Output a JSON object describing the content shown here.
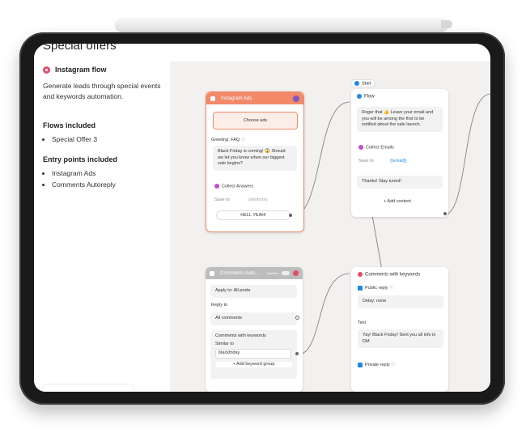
{
  "sidebar": {
    "title": "Special offers",
    "flow_name": "Instagram flow",
    "description": "Generate leads through special events and keywords automation.",
    "flows_heading": "Flows included",
    "flows": [
      "Special Offer 3"
    ],
    "entry_heading": "Entry points included",
    "entry_points": [
      "Instagram Ads",
      "Comments Autoreply"
    ]
  },
  "canvas": {
    "start_label": "Start",
    "ig_ads": {
      "title": "Instagram Ads",
      "choose_ads": "Choose ads",
      "greeting": "Greeting: FAQ",
      "message": "Black Friday is coming! 😱 Should we let you know when our biggest sale begins?",
      "collect": "Collect Answers",
      "save_to": "Save to",
      "save_var": "{attribute}",
      "button": "HELL YEAH!"
    },
    "flow": {
      "title": "Flow",
      "message": "Roger that 👍 Leave your email and you will be among the first to be notified about the sale launch.",
      "collect": "Collect Emails",
      "save_to": "Save to",
      "save_var": "{{email}}",
      "thanks": "Thanks! Stay tuned!",
      "add_content": "+ Add content"
    },
    "comments_auto": {
      "title": "Comments Auto...",
      "toggle_label": "Inactive",
      "apply_to": "Apply to: All posts",
      "reply_to": "Reply to",
      "all_comments": "All comments",
      "with_keywords": "Comments with keywords",
      "similar_to": "Similar to",
      "keyword": "blackfriday",
      "add_group": "+ Add keyword group"
    },
    "comments_kw": {
      "title": "Comments with keywords",
      "public_reply": "Public reply",
      "delay": "Delay: none",
      "text_label": "Text",
      "text": "Yay! Black Friday! Sent you all info in DM",
      "private_reply": "Private reply"
    }
  },
  "colors": {
    "accent_red": "#e54b6a",
    "ig_header": "#f28a6a",
    "blue": "#1e88e5"
  }
}
